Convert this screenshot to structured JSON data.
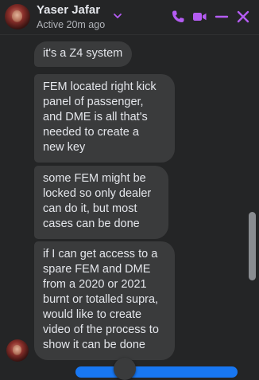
{
  "header": {
    "name": "Yaser Jafar",
    "status": "Active 20m ago",
    "icons": [
      "chevron-down-icon",
      "phone-icon",
      "video-camera-icon",
      "minimize-icon",
      "close-icon"
    ],
    "accent_color": "#b45cf2"
  },
  "messages": [
    {
      "text": "it's a Z4 system"
    },
    {
      "text": "FEM located right kick\npanel of passenger,\nand DME is all that's\nneeded to create a\nnew key"
    },
    {
      "text": "some FEM might be\nlocked so only dealer\ncan do it, but most\ncases can be done"
    },
    {
      "text": "if I can get access to a\nspare FEM and DME\nfrom a 2020 or 2021\nburnt or totalled supra,\nwould like to create\nvideo of the process to\nshow it can be done"
    }
  ],
  "colors": {
    "background": "#242526",
    "bubble": "#3a3b3c",
    "outgoing": "#1877f2"
  }
}
